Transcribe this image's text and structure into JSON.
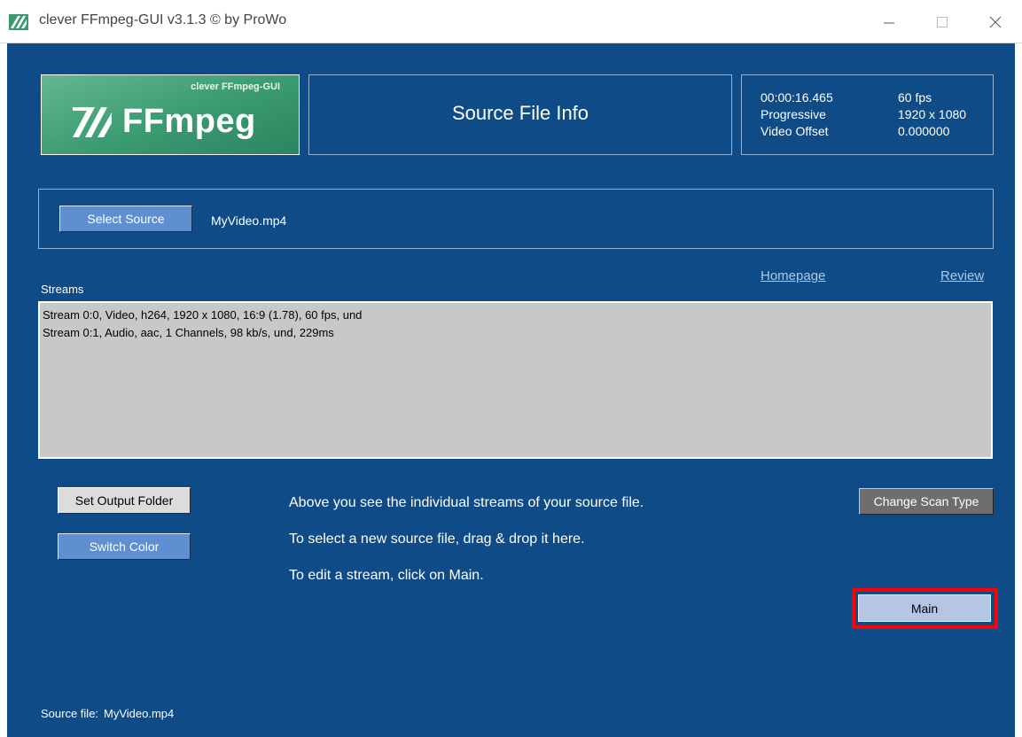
{
  "window": {
    "title": "clever FFmpeg-GUI v3.1.3   © by ProWo"
  },
  "logo": {
    "small_text": "clever FFmpeg-GUI",
    "big_text": "FFmpeg"
  },
  "header": {
    "title": "Source File Info"
  },
  "file_info": {
    "duration": "00:00:16.465",
    "fps": "60 fps",
    "scan_type": "Progressive",
    "resolution": "1920 x 1080",
    "video_offset_label": "Video Offset",
    "video_offset_value": "0.000000"
  },
  "source": {
    "select_label": "Select Source",
    "filename": "MyVideo.mp4"
  },
  "links": {
    "homepage": "Homepage",
    "review": "Review"
  },
  "streams": {
    "label": "Streams",
    "items": [
      "Stream 0:0, Video, h264, 1920 x 1080, 16:9 (1.78), 60 fps, und",
      "Stream 0:1, Audio, aac, 1 Channels, 98 kb/s, und, 229ms"
    ]
  },
  "buttons": {
    "set_output_folder": "Set Output Folder",
    "switch_color": "Switch Color",
    "change_scan_type": "Change Scan Type",
    "main": "Main"
  },
  "messages": [
    "Above you see the individual streams of your source file.",
    "To select a new source file, drag & drop it here.",
    "To edit a stream, click on Main."
  ],
  "footer": {
    "source_file_label": "Source file:",
    "source_file_value": "MyVideo.mp4"
  },
  "colors": {
    "background": "#0e4b87",
    "highlight": "#ff0000",
    "streams_bg": "#c8c8c8"
  }
}
